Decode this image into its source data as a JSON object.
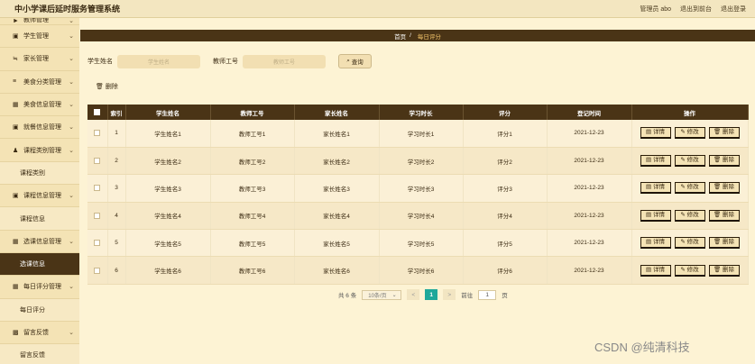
{
  "header": {
    "title": "中小学课后延时服务管理系统",
    "user": "管理员 abo",
    "to_frontend": "退出到前台",
    "logout": "退出登录"
  },
  "sidebar": {
    "items": [
      {
        "label": "教师管理",
        "type": "cut",
        "icon": "►"
      },
      {
        "label": "学生管理",
        "type": "menu",
        "icon": "▣"
      },
      {
        "label": "家长管理",
        "type": "menu",
        "icon": "≒"
      },
      {
        "label": "美食分类管理",
        "type": "menu",
        "icon": "≡"
      },
      {
        "label": "美食信息管理",
        "type": "menu",
        "icon": "▦"
      },
      {
        "label": "就餐信息管理",
        "type": "menu",
        "icon": "▣"
      },
      {
        "label": "课程类别管理",
        "type": "menu",
        "icon": "♟"
      },
      {
        "label": "课程类别",
        "type": "sub"
      },
      {
        "label": "课程信息管理",
        "type": "menu",
        "icon": "▣"
      },
      {
        "label": "课程信息",
        "type": "sub"
      },
      {
        "label": "选课信息管理",
        "type": "menu",
        "icon": "▦"
      },
      {
        "label": "选课信息",
        "type": "sub-active"
      },
      {
        "label": "每日评分管理",
        "type": "menu",
        "icon": "▦"
      },
      {
        "label": "每日评分",
        "type": "sub"
      },
      {
        "label": "留言反馈",
        "type": "menu",
        "icon": "▩"
      },
      {
        "label": "留言反馈",
        "type": "sub"
      }
    ]
  },
  "breadcrumb": {
    "home": "首页",
    "separator": "/",
    "current": "每日评分"
  },
  "search": {
    "student_label": "学生姓名",
    "student_placeholder": "学生姓名",
    "teacher_label": "教师工号",
    "teacher_placeholder": "教师工号",
    "button": "查询"
  },
  "toolbar": {
    "delete_label": "删除"
  },
  "table": {
    "columns": [
      "索引",
      "学生姓名",
      "教师工号",
      "家长姓名",
      "学习时长",
      "评分",
      "登记时间",
      "操作"
    ],
    "rows": [
      {
        "index": "1",
        "student": "学生姓名1",
        "teacher": "教师工号1",
        "parent": "家长姓名1",
        "duration": "学习时长1",
        "score": "评分1",
        "date": "2021-12-23"
      },
      {
        "index": "2",
        "student": "学生姓名2",
        "teacher": "教师工号2",
        "parent": "家长姓名2",
        "duration": "学习时长2",
        "score": "评分2",
        "date": "2021-12-23"
      },
      {
        "index": "3",
        "student": "学生姓名3",
        "teacher": "教师工号3",
        "parent": "家长姓名3",
        "duration": "学习时长3",
        "score": "评分3",
        "date": "2021-12-23"
      },
      {
        "index": "4",
        "student": "学生姓名4",
        "teacher": "教师工号4",
        "parent": "家长姓名4",
        "duration": "学习时长4",
        "score": "评分4",
        "date": "2021-12-23"
      },
      {
        "index": "5",
        "student": "学生姓名5",
        "teacher": "教师工号5",
        "parent": "家长姓名5",
        "duration": "学习时长5",
        "score": "评分5",
        "date": "2021-12-23"
      },
      {
        "index": "6",
        "student": "学生姓名6",
        "teacher": "教师工号6",
        "parent": "家长姓名6",
        "duration": "学习时长6",
        "score": "评分6",
        "date": "2021-12-23"
      }
    ],
    "actions": {
      "detail": "详情",
      "edit": "修改",
      "delete": "删除"
    }
  },
  "pagination": {
    "total": "共 6 条",
    "page_size": "10条/页",
    "prev": "<",
    "current": "1",
    "next": ">",
    "goto_label": "前往",
    "goto_value": "1",
    "page_unit": "页"
  },
  "watermark": "CSDN @纯清科技",
  "colors": {
    "accent": "#4a3416",
    "background": "#fdf3d4",
    "sidebar": "#f4e3b5",
    "page_active": "#1fa89a"
  }
}
